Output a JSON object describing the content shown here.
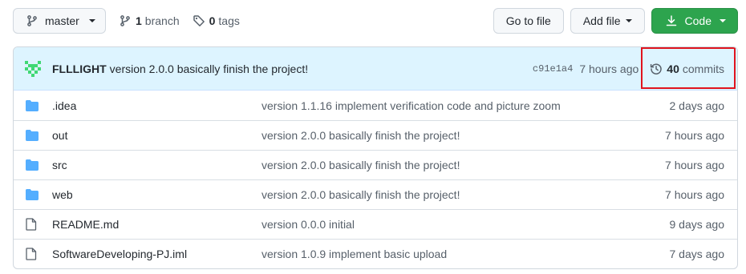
{
  "toolbar": {
    "branch_name": "master",
    "branch_count": "1",
    "branch_label": "branch",
    "tag_count": "0",
    "tag_label": "tags",
    "go_to_file_label": "Go to file",
    "add_file_label": "Add file",
    "code_label": "Code"
  },
  "latest_commit": {
    "author": "FLLLIGHT",
    "message": "version 2.0.0 basically finish the project!",
    "sha": "c91e1a4",
    "time": "7 hours ago",
    "commits_count": "40",
    "commits_label": "commits"
  },
  "files": [
    {
      "type": "folder",
      "name": ".idea",
      "message": "version 1.1.16 implement verification code and picture zoom",
      "age": "2 days ago"
    },
    {
      "type": "folder",
      "name": "out",
      "message": "version 2.0.0 basically finish the project!",
      "age": "7 hours ago"
    },
    {
      "type": "folder",
      "name": "src",
      "message": "version 2.0.0 basically finish the project!",
      "age": "7 hours ago"
    },
    {
      "type": "folder",
      "name": "web",
      "message": "version 2.0.0 basically finish the project!",
      "age": "7 hours ago"
    },
    {
      "type": "file",
      "name": "README.md",
      "message": "version 0.0.0 initial",
      "age": "9 days ago"
    },
    {
      "type": "file",
      "name": "SoftwareDeveloping-PJ.iml",
      "message": "version 1.0.9 implement basic upload",
      "age": "7 days ago"
    }
  ],
  "colors": {
    "folder": "#54aeff",
    "code_button": "#2da44e",
    "commit_header_bg": "#ddf4ff",
    "highlight_box": "#e0141e",
    "avatar": "#40d874"
  },
  "icons": {
    "branch_button": "git-branch-icon",
    "branches": "git-branch-icon",
    "tags": "tag-icon",
    "code": "download-icon",
    "commits": "history-icon",
    "folder": "folder-icon",
    "file": "file-icon"
  }
}
